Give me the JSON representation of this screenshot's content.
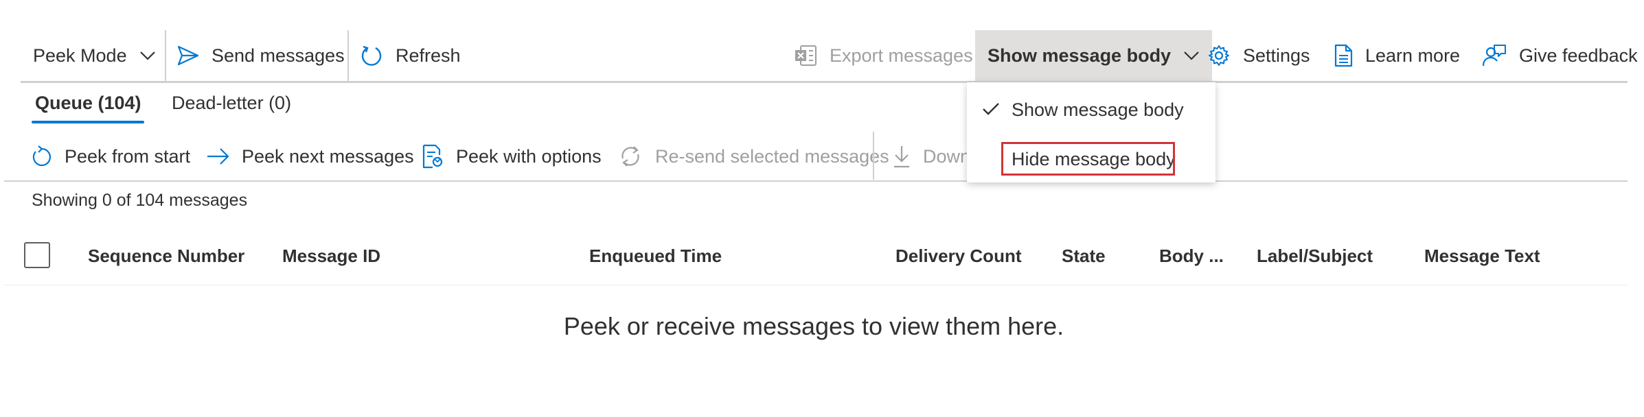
{
  "toolbar": {
    "peek_mode": "Peek Mode",
    "send_messages": "Send messages",
    "refresh": "Refresh",
    "export_messages": "Export messages",
    "show_message_body": "Show message body",
    "settings": "Settings",
    "learn_more": "Learn more",
    "give_feedback": "Give feedback"
  },
  "tabs": [
    {
      "label": "Queue (104)",
      "active": true
    },
    {
      "label": "Dead-letter (0)",
      "active": false
    }
  ],
  "actions": {
    "peek_from_start": "Peek from start",
    "peek_next": "Peek next messages",
    "peek_with_options": "Peek with options",
    "resend": "Re-send selected messages",
    "download": "Down"
  },
  "status": {
    "count": "Showing 0 of 104 messages"
  },
  "table": {
    "columns": [
      "Sequence Number",
      "Message ID",
      "Enqueued Time",
      "Delivery Count",
      "State",
      "Body ...",
      "Label/Subject",
      "Message Text"
    ],
    "empty_text": "Peek or receive messages to view them here."
  },
  "menu": {
    "items": [
      {
        "label": "Show message body",
        "checked": true
      },
      {
        "label": "Hide message body",
        "checked": false
      }
    ]
  },
  "colors": {
    "accent": "#0078d4",
    "highlight_border": "#d13438",
    "disabled": "#a19f9d",
    "selected_bg": "#e1dfdd"
  },
  "icons": [
    "chevron-down-icon",
    "send-icon",
    "refresh-icon",
    "excel-icon",
    "gear-icon",
    "document-icon",
    "feedback-icon",
    "rotate-icon",
    "arrow-right-icon",
    "peek-options-icon",
    "resend-icon",
    "download-icon",
    "checkmark-icon"
  ]
}
